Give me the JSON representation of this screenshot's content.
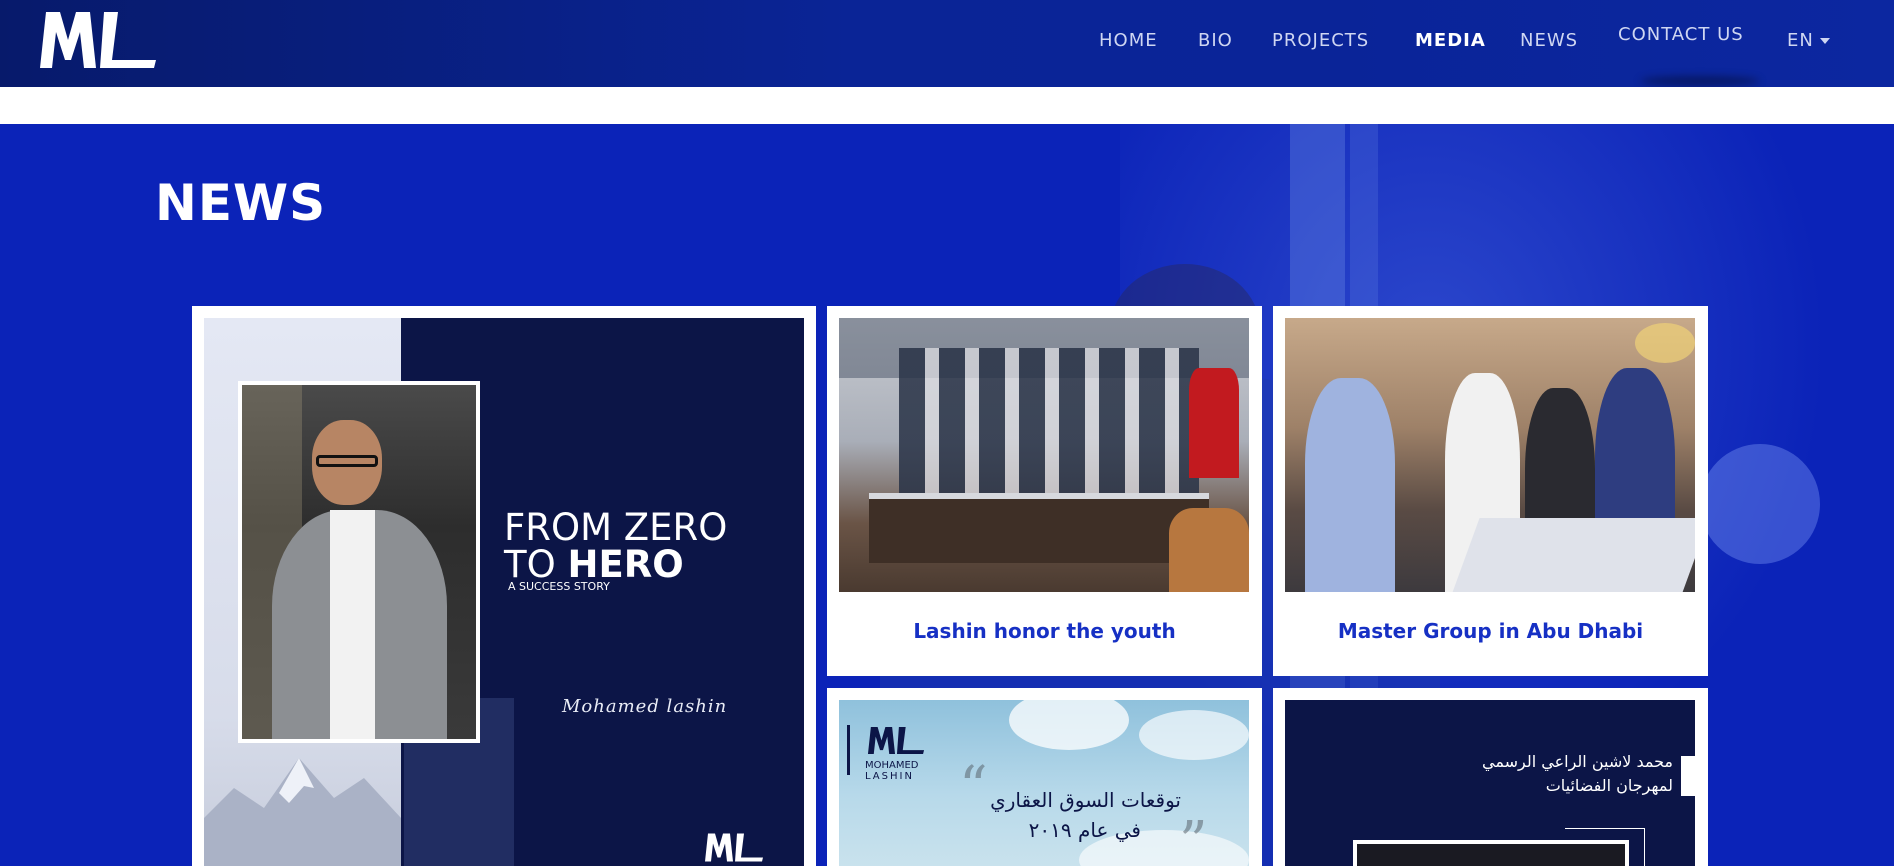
{
  "header": {
    "logo_alt": "ML",
    "nav": [
      {
        "label": "HOME",
        "active": false
      },
      {
        "label": "BIO",
        "active": false
      },
      {
        "label": "PROJECTS",
        "active": false
      },
      {
        "label": "MEDIA",
        "active": true
      },
      {
        "label": "NEWS",
        "active": false
      },
      {
        "label": "CONTACT US",
        "active": false
      }
    ],
    "language": "EN"
  },
  "section": {
    "title": "NEWS"
  },
  "cards": {
    "feature": {
      "headline_line1": "FROM ZERO",
      "headline_line2_prefix": "TO ",
      "headline_line2_bold": "HERO",
      "tagline": "A SUCCESS STORY",
      "signature": "Mohamed lashin"
    },
    "card1": {
      "caption": "Lashin honor the youth"
    },
    "card2": {
      "caption": "Master Group in Abu Dhabi"
    },
    "card3": {
      "logo_line1": "MOHAMED",
      "logo_line2": "LASHIN",
      "arabic_line1": "توقعات السوق العقاري",
      "arabic_line2": "في عام ٢٠١٩"
    },
    "card4": {
      "arabic_line1": "محمد لاشين الراعي الرسمي",
      "arabic_line2": "لمهرجان الفضائيات"
    }
  },
  "colors": {
    "header_blue": "#0a2496",
    "section_blue": "#0b23b8",
    "caption_blue": "#1630c4",
    "poster_navy": "#0c1547"
  }
}
